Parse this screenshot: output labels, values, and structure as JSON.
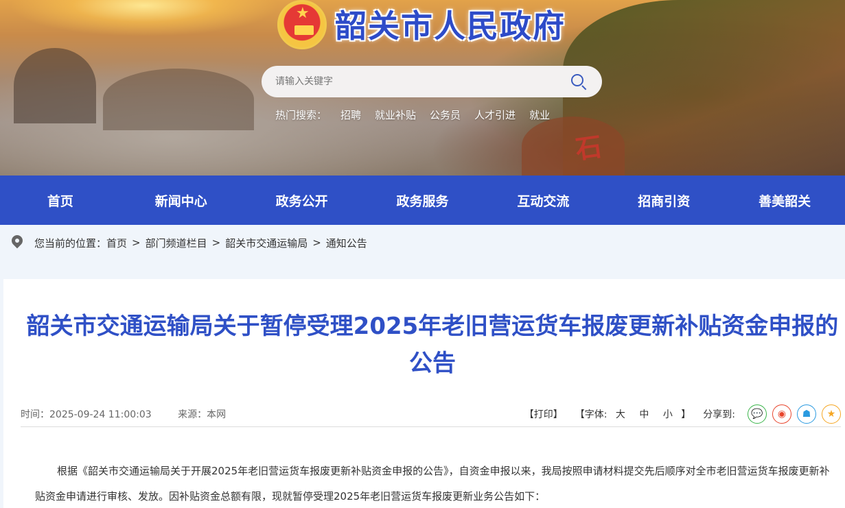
{
  "header": {
    "site_title": "韶关市人民政府",
    "search_placeholder": "请输入关键字",
    "hot_label": "热门搜索：",
    "hot_items": [
      "招聘",
      "就业补贴",
      "公务员",
      "人才引进",
      "就业"
    ],
    "banner_carving": "石"
  },
  "nav": {
    "items": [
      "首页",
      "新闻中心",
      "政务公开",
      "政务服务",
      "互动交流",
      "招商引资",
      "善美韶关"
    ]
  },
  "breadcrumb": {
    "label": "您当前的位置：",
    "items": [
      "首页",
      "部门频道栏目",
      "韶关市交通运输局",
      "通知公告"
    ],
    "separator": ">"
  },
  "article": {
    "title": "韶关市交通运输局关于暂停受理2025年老旧营运货车报废更新补贴资金申报的公告",
    "time": "时间：2025-09-24 11:00:03",
    "source": "来源：本网",
    "print": "【打印】",
    "font_label": "【字体:",
    "font_sizes": [
      "大",
      "中",
      "小"
    ],
    "font_close": "】",
    "share_label": "分享到:",
    "share_icons": [
      "wechat-icon",
      "weibo-icon",
      "qq-icon",
      "favorite-icon"
    ],
    "body": "根据《韶关市交通运输局关于开展2025年老旧营运货车报废更新补贴资金申报的公告》，自资金申报以来，我局按照申请材料提交先后顺序对全市老旧营运货车报废更新补贴资金申请进行审核、发放。因补贴资金总额有限，现就暂停受理2025年老旧营运货车报废更新业务公告如下："
  }
}
